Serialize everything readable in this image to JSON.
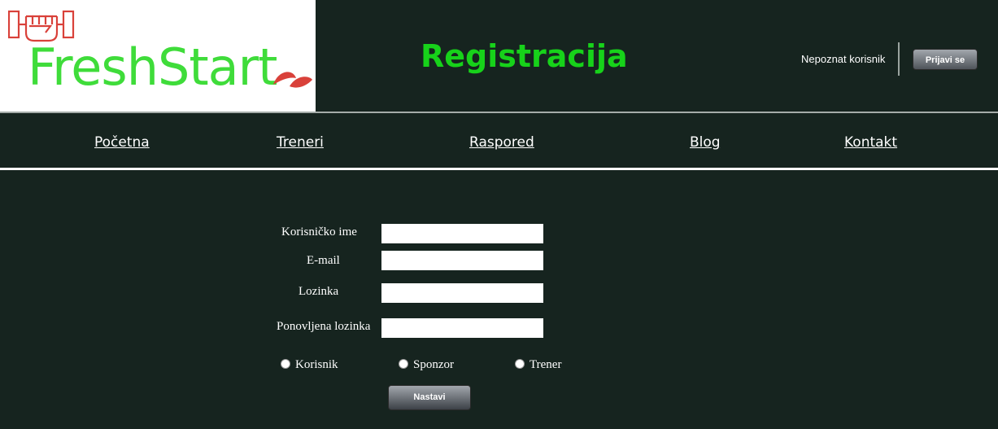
{
  "header": {
    "logo_text": "FreshStart",
    "page_title": "Registracija",
    "user_status": "Nepoznat korisnik",
    "login_label": "Prijavi se"
  },
  "nav": {
    "items": [
      {
        "label": "Početna"
      },
      {
        "label": "Treneri"
      },
      {
        "label": "Raspored"
      },
      {
        "label": "Blog"
      },
      {
        "label": "Kontakt"
      }
    ]
  },
  "form": {
    "fields": [
      {
        "label": "Korisničko ime",
        "value": ""
      },
      {
        "label": "E-mail",
        "value": ""
      },
      {
        "label": "Lozinka",
        "value": ""
      },
      {
        "label": "Ponovljena lozinka",
        "value": ""
      }
    ],
    "roles": [
      {
        "label": "Korisnik",
        "selected": false
      },
      {
        "label": "Sponzor",
        "selected": false
      },
      {
        "label": "Trener",
        "selected": false
      }
    ],
    "submit_label": "Nastavi"
  },
  "colors": {
    "background": "#16241f",
    "title_green": "#17d21a",
    "logo_green": "#3fdc3a",
    "logo_red": "#d9413a"
  },
  "icons": {
    "logo_mark": "fist-icon",
    "logo_leaf": "leaf-icon"
  }
}
